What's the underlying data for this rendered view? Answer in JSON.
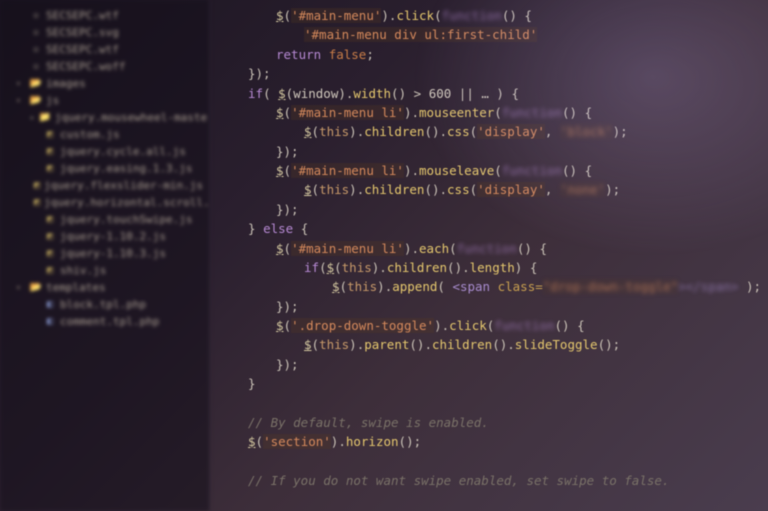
{
  "sidebar": {
    "items": [
      {
        "depth": 1,
        "icon": "file-wtf",
        "label": "SECSEPC.wtf"
      },
      {
        "depth": 1,
        "icon": "file-wtf",
        "label": "SECSEPC.svg"
      },
      {
        "depth": 1,
        "icon": "file-wtf",
        "label": "SECSEPC.wtf"
      },
      {
        "depth": 1,
        "icon": "file-wtf",
        "label": "SECSEPC.woff"
      },
      {
        "depth": 1,
        "icon": "folder-open",
        "label": "images",
        "arrow": "▾"
      },
      {
        "depth": 1,
        "icon": "folder-open",
        "label": "js",
        "arrow": "▾"
      },
      {
        "depth": 2,
        "icon": "folder",
        "label": "jquery.mousewheel-master",
        "arrow": "▸"
      },
      {
        "depth": 2,
        "icon": "file-js",
        "label": "custom.js"
      },
      {
        "depth": 2,
        "icon": "file-js",
        "label": "jquery.cycle.all.js"
      },
      {
        "depth": 2,
        "icon": "file-js",
        "label": "jquery.easing.1.3.js"
      },
      {
        "depth": 2,
        "icon": "file-js",
        "label": "jquery.flexslider-min.js"
      },
      {
        "depth": 2,
        "icon": "file-js",
        "label": "jquery.horizontal.scroll.js"
      },
      {
        "depth": 2,
        "icon": "file-js",
        "label": "jquery.touchSwipe.js"
      },
      {
        "depth": 2,
        "icon": "file-js",
        "label": "jquery-1.10.2.js"
      },
      {
        "depth": 2,
        "icon": "file-js",
        "label": "jquery-1.10.3.js"
      },
      {
        "depth": 2,
        "icon": "file-js",
        "label": "shiv.js"
      },
      {
        "depth": 1,
        "icon": "folder-open",
        "label": "templates",
        "arrow": "▾"
      },
      {
        "depth": 2,
        "icon": "file-php",
        "label": "block.tpl.php"
      },
      {
        "depth": 2,
        "icon": "file-php",
        "label": "comment.tpl.php"
      }
    ]
  },
  "code": {
    "lines": [
      {
        "i": 3,
        "tokens": [
          [
            "jq",
            "$"
          ],
          [
            "punc",
            "("
          ],
          [
            "str",
            "'#main-menu'"
          ],
          [
            "punc",
            ")."
          ],
          [
            "fn",
            "click"
          ],
          [
            "punc",
            "("
          ],
          [
            "kw",
            "function"
          ],
          [
            "punc",
            "() {"
          ]
        ]
      },
      {
        "i": 4,
        "tokens": [
          [
            "str",
            "'#main-menu div ul:first-child'"
          ]
        ]
      },
      {
        "i": 3,
        "tokens": [
          [
            "kw",
            "return "
          ],
          [
            "bool",
            "false"
          ],
          [
            "punc",
            ";"
          ]
        ]
      },
      {
        "i": 2,
        "tokens": [
          [
            "punc",
            "});"
          ]
        ]
      },
      {
        "i": 2,
        "tokens": [
          [
            "kw",
            "if"
          ],
          [
            "punc",
            "( "
          ],
          [
            "jq",
            "$"
          ],
          [
            "punc",
            "("
          ],
          [
            "var",
            "window"
          ],
          [
            "punc",
            ")."
          ],
          [
            "fn",
            "width"
          ],
          [
            "punc",
            "() > "
          ],
          [
            "var",
            "600"
          ],
          [
            "punc",
            " || "
          ],
          [
            "var",
            "…"
          ],
          [
            "punc",
            " ) {"
          ]
        ]
      },
      {
        "i": 3,
        "tokens": [
          [
            "jq",
            "$"
          ],
          [
            "punc",
            "("
          ],
          [
            "str",
            "'#main-menu li'"
          ],
          [
            "punc",
            ")."
          ],
          [
            "fn",
            "mouseenter"
          ],
          [
            "punc",
            "("
          ],
          [
            "kw",
            "function"
          ],
          [
            "punc",
            "() {"
          ]
        ]
      },
      {
        "i": 4,
        "tokens": [
          [
            "jq",
            "$"
          ],
          [
            "punc",
            "("
          ],
          [
            "this",
            "this"
          ],
          [
            "punc",
            ")."
          ],
          [
            "fn",
            "children"
          ],
          [
            "punc",
            "()."
          ],
          [
            "fn",
            "css"
          ],
          [
            "punc",
            "("
          ],
          [
            "str",
            "'display'"
          ],
          [
            "punc",
            ", "
          ],
          [
            "str",
            "'block'"
          ],
          [
            "punc",
            ");"
          ]
        ]
      },
      {
        "i": 3,
        "tokens": [
          [
            "punc",
            "});"
          ]
        ]
      },
      {
        "i": 3,
        "tokens": [
          [
            "jq",
            "$"
          ],
          [
            "punc",
            "("
          ],
          [
            "str",
            "'#main-menu li'"
          ],
          [
            "punc",
            ")."
          ],
          [
            "fn",
            "mouseleave"
          ],
          [
            "punc",
            "("
          ],
          [
            "kw",
            "function"
          ],
          [
            "punc",
            "() {"
          ]
        ]
      },
      {
        "i": 4,
        "tokens": [
          [
            "jq",
            "$"
          ],
          [
            "punc",
            "("
          ],
          [
            "this",
            "this"
          ],
          [
            "punc",
            ")."
          ],
          [
            "fn",
            "children"
          ],
          [
            "punc",
            "()."
          ],
          [
            "fn",
            "css"
          ],
          [
            "punc",
            "("
          ],
          [
            "str",
            "'display'"
          ],
          [
            "punc",
            ", "
          ],
          [
            "str",
            "'none'"
          ],
          [
            "punc",
            ");"
          ]
        ]
      },
      {
        "i": 3,
        "tokens": [
          [
            "punc",
            "});"
          ]
        ]
      },
      {
        "i": 2,
        "tokens": [
          [
            "punc",
            "} "
          ],
          [
            "kw",
            "else"
          ],
          [
            "punc",
            " {"
          ]
        ]
      },
      {
        "i": 3,
        "tokens": [
          [
            "jq",
            "$"
          ],
          [
            "punc",
            "("
          ],
          [
            "str",
            "'#main-menu li'"
          ],
          [
            "punc",
            ")."
          ],
          [
            "fn",
            "each"
          ],
          [
            "punc",
            "("
          ],
          [
            "kw",
            "function"
          ],
          [
            "punc",
            "() {"
          ]
        ]
      },
      {
        "i": 4,
        "tokens": [
          [
            "kw",
            "if"
          ],
          [
            "punc",
            "("
          ],
          [
            "jq",
            "$"
          ],
          [
            "punc",
            "("
          ],
          [
            "this",
            "this"
          ],
          [
            "punc",
            ")."
          ],
          [
            "fn",
            "children"
          ],
          [
            "punc",
            "()."
          ],
          [
            "fn",
            "length"
          ],
          [
            "punc",
            ") {"
          ]
        ]
      },
      {
        "i": 5,
        "tokens": [
          [
            "jq",
            "$"
          ],
          [
            "punc",
            "("
          ],
          [
            "this",
            "this"
          ],
          [
            "punc",
            ")."
          ],
          [
            "fn",
            "append"
          ],
          [
            "punc",
            "( "
          ],
          [
            "tag",
            "<span "
          ],
          [
            "attr",
            "class="
          ],
          [
            "str",
            "\"drop-down-toggle\""
          ],
          [
            "tag",
            "></span>"
          ],
          [
            "punc",
            " );"
          ]
        ]
      },
      {
        "i": 3,
        "tokens": [
          [
            "punc",
            "});"
          ]
        ]
      },
      {
        "i": 3,
        "tokens": [
          [
            "jq",
            "$"
          ],
          [
            "punc",
            "("
          ],
          [
            "str",
            "'.drop-down-toggle'"
          ],
          [
            "punc",
            ")."
          ],
          [
            "fn",
            "click"
          ],
          [
            "punc",
            "("
          ],
          [
            "kw",
            "function"
          ],
          [
            "punc",
            "() {"
          ]
        ]
      },
      {
        "i": 4,
        "tokens": [
          [
            "jq",
            "$"
          ],
          [
            "punc",
            "("
          ],
          [
            "this",
            "this"
          ],
          [
            "punc",
            ")."
          ],
          [
            "fn",
            "parent"
          ],
          [
            "punc",
            "()."
          ],
          [
            "fn",
            "children"
          ],
          [
            "punc",
            "()."
          ],
          [
            "fn",
            "slideToggle"
          ],
          [
            "punc",
            "();"
          ]
        ]
      },
      {
        "i": 3,
        "tokens": [
          [
            "punc",
            "});"
          ]
        ]
      },
      {
        "i": 2,
        "tokens": [
          [
            "punc",
            "}"
          ]
        ]
      },
      {
        "i": 1,
        "tokens": [
          [
            "punc",
            " "
          ]
        ]
      },
      {
        "i": 2,
        "tokens": [
          [
            "comment",
            "// By default, swipe is enabled."
          ]
        ]
      },
      {
        "i": 2,
        "tokens": [
          [
            "jq",
            "$"
          ],
          [
            "punc",
            "("
          ],
          [
            "str",
            "'section'"
          ],
          [
            "punc",
            ")."
          ],
          [
            "fn",
            "horizon"
          ],
          [
            "punc",
            "();"
          ]
        ]
      },
      {
        "i": 1,
        "tokens": [
          [
            "punc",
            " "
          ]
        ]
      },
      {
        "i": 2,
        "tokens": [
          [
            "comment",
            "// If you do not want swipe enabled, set swipe to false."
          ]
        ]
      }
    ]
  },
  "icons": {
    "folder": "📁",
    "folder-open": "📂",
    "file": "▫",
    "arrow-right": "▸",
    "arrow-down": "▾"
  }
}
